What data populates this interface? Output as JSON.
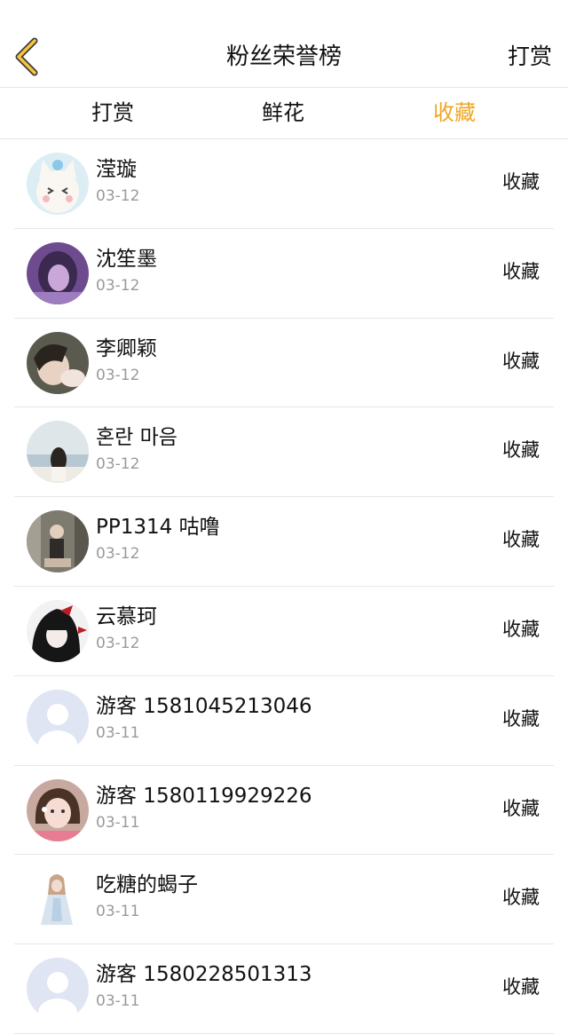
{
  "header": {
    "title": "粉丝荣誉榜",
    "right_label": "打赏",
    "accent_color": "#f0a625"
  },
  "tabs": [
    {
      "label": "打赏",
      "active": false
    },
    {
      "label": "鲜花",
      "active": false
    },
    {
      "label": "收藏",
      "active": true
    }
  ],
  "fans": [
    {
      "name": "滢璇",
      "date": "03-12",
      "action": "收藏",
      "avatar": "cartoon-cat-avatar"
    },
    {
      "name": "沈笙墨",
      "date": "03-12",
      "action": "收藏",
      "avatar": "purple-photo-avatar"
    },
    {
      "name": "李卿颖",
      "date": "03-12",
      "action": "收藏",
      "avatar": "girl-photo-avatar"
    },
    {
      "name": "혼란 마음",
      "date": "03-12",
      "action": "收藏",
      "avatar": "seaside-photo-avatar"
    },
    {
      "name": "PP1314 咕噜",
      "date": "03-12",
      "action": "收藏",
      "avatar": "street-photo-avatar"
    },
    {
      "name": "云慕珂",
      "date": "03-12",
      "action": "收藏",
      "avatar": "dark-anime-avatar"
    },
    {
      "name": "游客 1581045213046",
      "date": "03-11",
      "action": "收藏",
      "avatar": "default-user-avatar"
    },
    {
      "name": "游客 1580119929226",
      "date": "03-11",
      "action": "收藏",
      "avatar": "girl-pink-avatar"
    },
    {
      "name": "吃糖的蝎子",
      "date": "03-11",
      "action": "收藏",
      "avatar": "white-dress-avatar"
    },
    {
      "name": "游客 1580228501313",
      "date": "03-11",
      "action": "收藏",
      "avatar": "default-user-avatar"
    }
  ]
}
